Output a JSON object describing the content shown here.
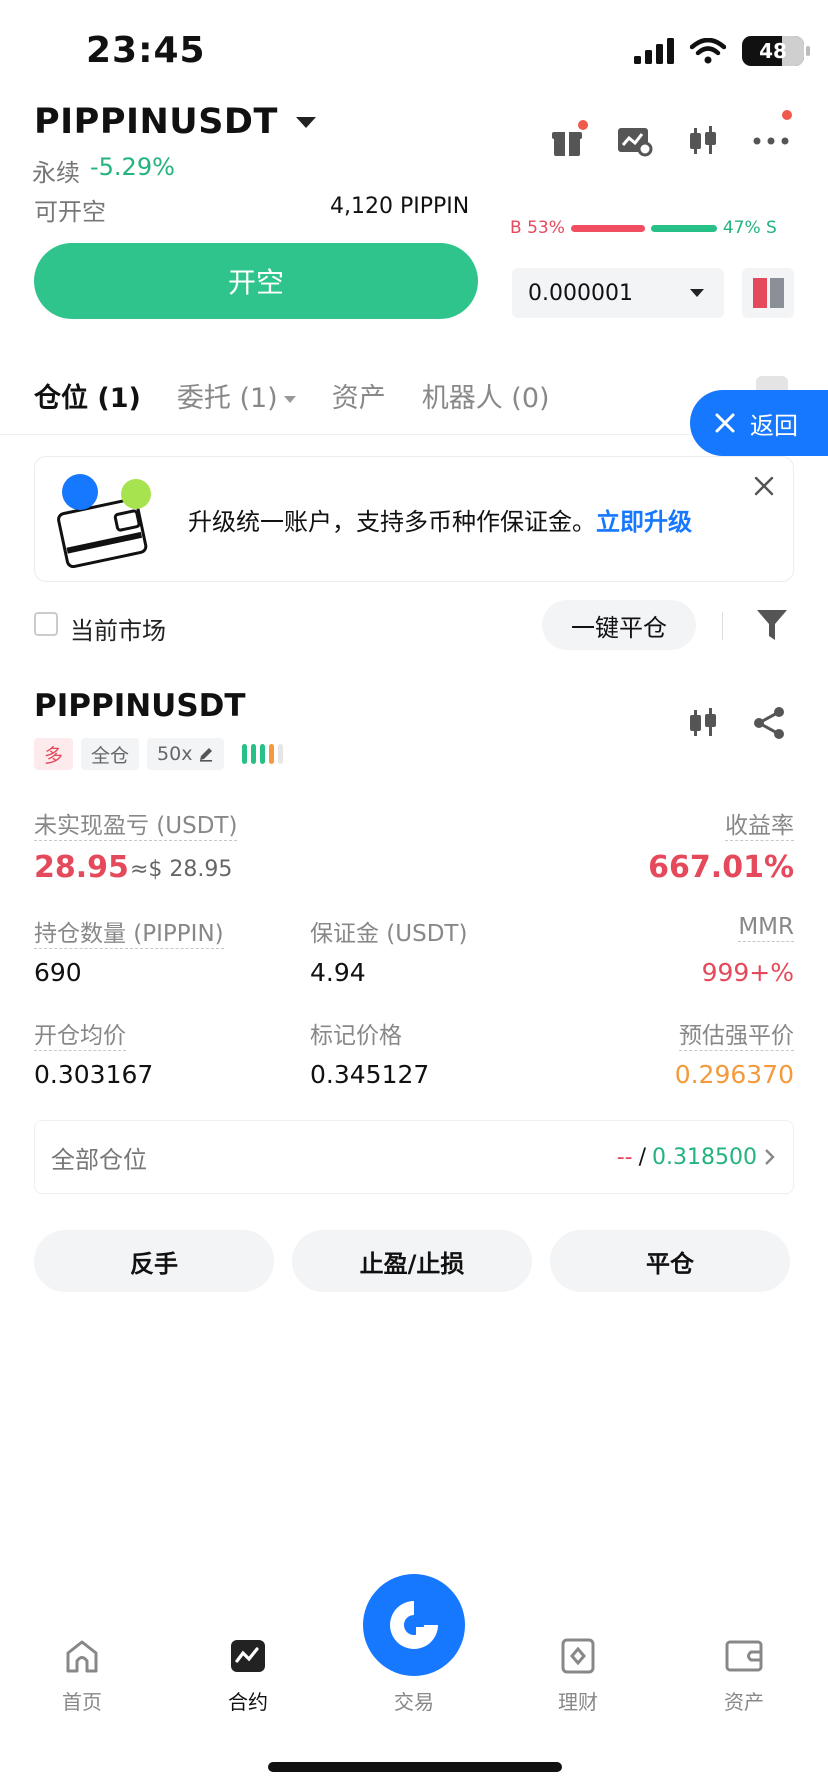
{
  "status_bar": {
    "time": "23:45",
    "battery": "48"
  },
  "header": {
    "pair": "PIPPINUSDT",
    "contract_type": "永续",
    "change": "-5.29%",
    "available_label": "可开空",
    "available_value": "4,120 PIPPIN",
    "icons": [
      "gift-icon",
      "chart-settings-icon",
      "candlestick-icon",
      "more-icon"
    ]
  },
  "order_book": {
    "buy_label": "B 53%",
    "sell_label": "47% S",
    "buy_pct": 53,
    "sell_pct": 47,
    "precision": "0.000001"
  },
  "open_button": "开空",
  "tabs": [
    {
      "label": "仓位 (1)"
    },
    {
      "label": "委托 (1)"
    },
    {
      "label": "资产"
    },
    {
      "label": "机器人 (0)"
    }
  ],
  "back_button": "返回",
  "promo": {
    "text": "升级统一账户，支持多币种作保证金。",
    "link": "立即升级"
  },
  "filter": {
    "current_market": "当前市场",
    "close_all": "一键平仓"
  },
  "position": {
    "symbol": "PIPPINUSDT",
    "side": "多",
    "margin_mode": "全仓",
    "leverage": "50x",
    "unrealized_label": "未实现盈亏 (USDT)",
    "unrealized_value": "28.95",
    "unrealized_usd": "≈$ 28.95",
    "roe_label": "收益率",
    "roe_value": "667.01%",
    "size_label": "持仓数量 (PIPPIN)",
    "size_value": "690",
    "margin_label": "保证金 (USDT)",
    "margin_value": "4.94",
    "mmr_label": "MMR",
    "mmr_value": "999+%",
    "entry_label": "开仓均价",
    "entry_value": "0.303167",
    "mark_label": "标记价格",
    "mark_value": "0.345127",
    "liq_label": "预估强平价",
    "liq_value": "0.296370",
    "all_positions_label": "全部仓位",
    "all_positions_left": "--",
    "all_positions_sep": "/",
    "all_positions_right": "0.318500"
  },
  "actions": {
    "reverse": "反手",
    "tp_sl": "止盈/止损",
    "close": "平仓"
  },
  "bottom_nav": [
    {
      "label": "首页",
      "icon": "home-icon"
    },
    {
      "label": "合约",
      "icon": "futures-icon"
    },
    {
      "label": "交易",
      "icon": "trade-icon"
    },
    {
      "label": "理财",
      "icon": "earn-icon"
    },
    {
      "label": "资产",
      "icon": "wallet-icon"
    }
  ],
  "colors": {
    "green": "#2ec48b",
    "red": "#e54a5c",
    "blue": "#1677ff",
    "orange": "#f39a3d"
  }
}
